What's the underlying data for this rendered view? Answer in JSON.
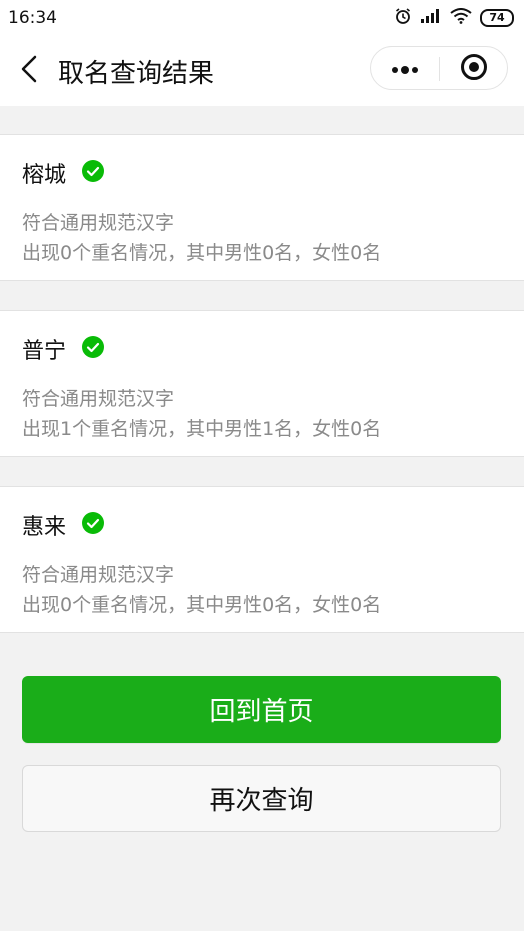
{
  "status_bar": {
    "time": "16:34",
    "battery": "74",
    "icons": [
      "alarm-icon",
      "signal-icon",
      "wifi-icon",
      "battery-icon"
    ]
  },
  "nav": {
    "title": "取名查询结果",
    "icons": [
      "back-icon",
      "more-icon",
      "close-mini-program-icon"
    ]
  },
  "results": [
    {
      "name": "榕城",
      "line1": "符合通用规范汉字",
      "line2": "出现0个重名情况，其中男性0名，女性0名"
    },
    {
      "name": "普宁",
      "line1": "符合通用规范汉字",
      "line2": "出现1个重名情况，其中男性1名，女性0名"
    },
    {
      "name": "惠来",
      "line1": "符合通用规范汉字",
      "line2": "出现0个重名情况，其中男性0名，女性0名"
    }
  ],
  "actions": {
    "home_label": "回到首页",
    "requery_label": "再次查询"
  },
  "colors": {
    "primary": "#1aad19",
    "check": "#09bb07",
    "background": "#f2f2f2"
  }
}
